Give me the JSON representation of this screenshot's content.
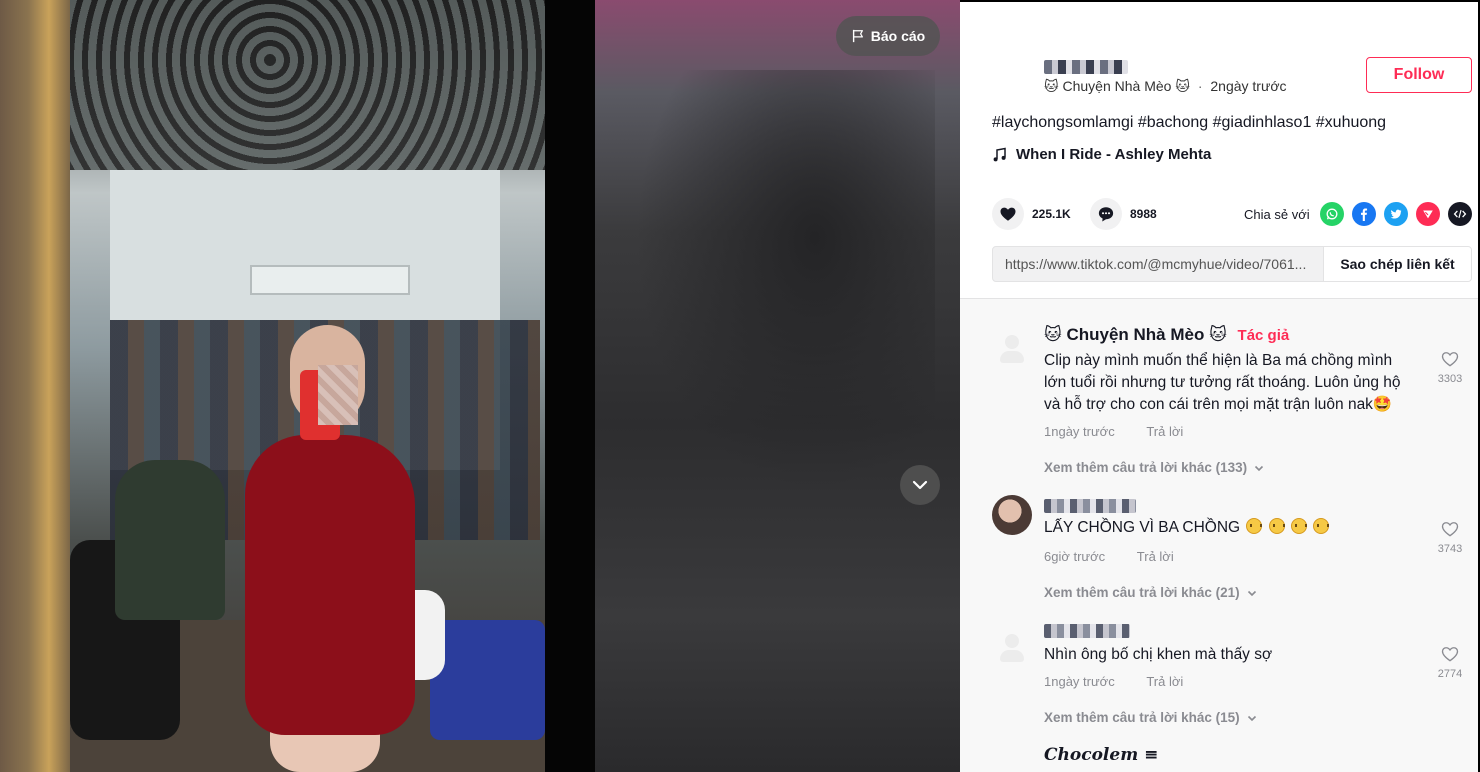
{
  "video": {
    "report_label": "Báo cáo"
  },
  "author": {
    "nickname": "🐱 Chuyện Nhà Mèo 🐱",
    "separator": "·",
    "posted_ago": "2ngày trước",
    "follow_label": "Follow"
  },
  "post": {
    "caption": "#laychongsomlamgi #bachong #giadinhlaso1 #xuhuong",
    "music": "When I Ride - Ashley Mehta",
    "likes": "225.1K",
    "comments": "8988",
    "share_label": "Chia sẻ với",
    "share_targets": [
      "whatsapp-icon",
      "facebook-icon",
      "twitter-icon",
      "telegram-icon",
      "embed-icon"
    ],
    "link": "https://www.tiktok.com/@mcmyhue/video/7061...",
    "copy_link_label": "Sao chép liên kết"
  },
  "comments": [
    {
      "name": "🐱 Chuyện Nhà Mèo 🐱",
      "badge": "Tác giả",
      "text": "Clip này mình muốn thể hiện là Ba má chồng mình lớn tuổi rồi nhưng tư tưởng rất thoáng. Luôn ủng hộ và hỗ trợ cho con cái trên mọi mặt trận luôn nak🤩",
      "time": "1ngày trước",
      "reply_label": "Trả lời",
      "likes": "3303",
      "more_replies": "Xem thêm câu trả lời khác (133)"
    },
    {
      "name": "",
      "text": "LẤY CHỒNG VÌ BA CHỒNG",
      "time": "6giờ trước",
      "reply_label": "Trả lời",
      "likes": "3743",
      "more_replies": "Xem thêm câu trả lời khác (21)"
    },
    {
      "name": "",
      "text": "Nhìn ông bố chị khen mà thấy sợ",
      "time": "1ngày trước",
      "reply_label": "Trả lời",
      "likes": "2774",
      "more_replies": "Xem thêm câu trả lời khác (15)"
    },
    {
      "name": "𝑪𝒉𝒐𝒄𝒐𝒍𝒆𝒎 ≡"
    }
  ],
  "colors": {
    "accent": "#fe2c55",
    "whatsapp": "#25d366",
    "facebook": "#1877f2",
    "twitter": "#1da1f2",
    "telegram": "#fe2c55",
    "embed": "#161823"
  }
}
